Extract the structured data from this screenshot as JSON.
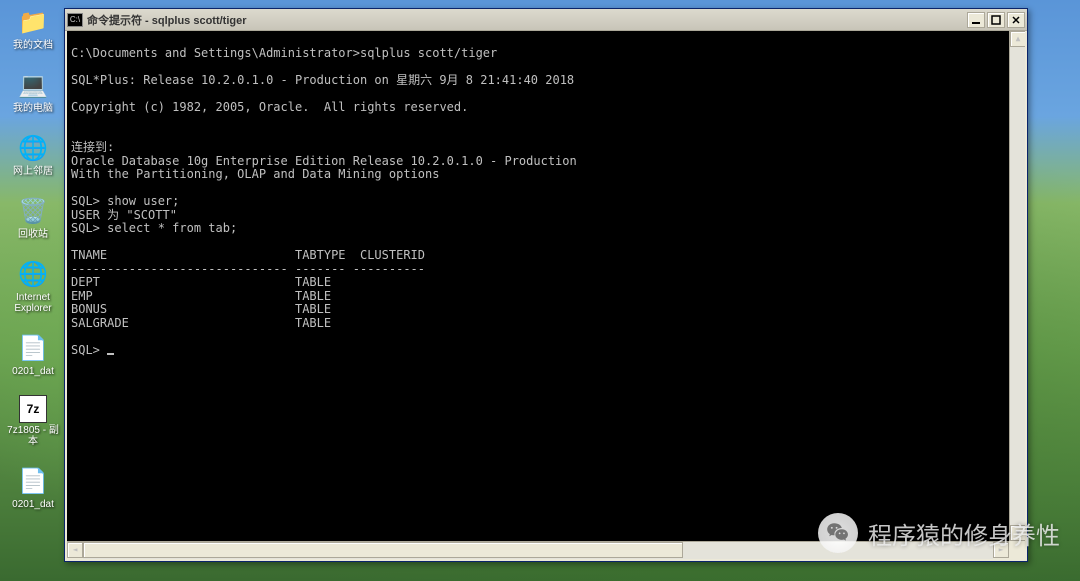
{
  "desktop": {
    "icons": [
      {
        "label": "我的文档",
        "glyph": "📁"
      },
      {
        "label": "我的电脑",
        "glyph": "💻"
      },
      {
        "label": "网上邻居",
        "glyph": "🌐"
      },
      {
        "label": "回收站",
        "glyph": "🗑️"
      },
      {
        "label": "Internet Explorer",
        "glyph": "🌐"
      },
      {
        "label": "0201_dat",
        "glyph": "📄"
      },
      {
        "label": "7z1805 - 副本",
        "glyph": "7z"
      },
      {
        "label": "0201_dat",
        "glyph": "📄"
      }
    ]
  },
  "window": {
    "title": "命令提示符 - sqlplus scott/tiger"
  },
  "terminal": {
    "line_prompt": "C:\\Documents and Settings\\Administrator>sqlplus scott/tiger",
    "blank1": "",
    "release": "SQL*Plus: Release 10.2.0.1.0 - Production on 星期六 9月 8 21:41:40 2018",
    "blank2": "",
    "copyright": "Copyright (c) 1982, 2005, Oracle.  All rights reserved.",
    "blank3": "",
    "blank4": "",
    "connect": "连接到:",
    "db1": "Oracle Database 10g Enterprise Edition Release 10.2.0.1.0 - Production",
    "db2": "With the Partitioning, OLAP and Data Mining options",
    "blank5": "",
    "sql1": "SQL> show user;",
    "user": "USER 为 \"SCOTT\"",
    "sql2": "SQL> select * from tab;",
    "blank6": "",
    "header": "TNAME                          TABTYPE  CLUSTERID",
    "divider": "------------------------------ ------- ----------",
    "row1": "DEPT                           TABLE",
    "row2": "EMP                            TABLE",
    "row3": "BONUS                          TABLE",
    "row4": "SALGRADE                       TABLE",
    "blank7": "",
    "sql3": "SQL> "
  },
  "watermark": {
    "text": "程序猿的修身养性"
  }
}
